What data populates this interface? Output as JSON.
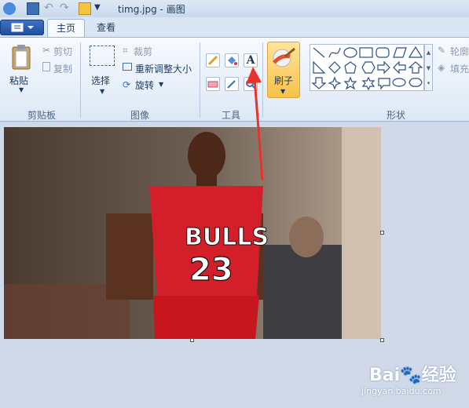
{
  "window": {
    "title": "timg.jpg - 画图"
  },
  "tabs": [
    {
      "label": "主页"
    },
    {
      "label": "查看"
    }
  ],
  "clipboard": {
    "paste": "粘贴",
    "cut": "剪切",
    "copy": "复制",
    "group": "剪贴板"
  },
  "image_group": {
    "select": "选择",
    "crop": "裁剪",
    "resize": "重新调整大小",
    "rotate": "旋转",
    "group": "图像"
  },
  "tools": {
    "group": "工具",
    "text_glyph": "A"
  },
  "brushes": {
    "label": "刷子"
  },
  "shapes": {
    "group": "形状",
    "outline": "轮廓",
    "fill": "填充"
  },
  "photo": {
    "jersey_team": "BULLS",
    "jersey_number": "23"
  },
  "watermark": {
    "brand": "Bai",
    "brand2": "经验",
    "url": "jingyan.baidu.com"
  },
  "colors": {
    "accent": "#f7c24a",
    "arrow": "#e8332b",
    "jersey": "#d21f2a"
  }
}
